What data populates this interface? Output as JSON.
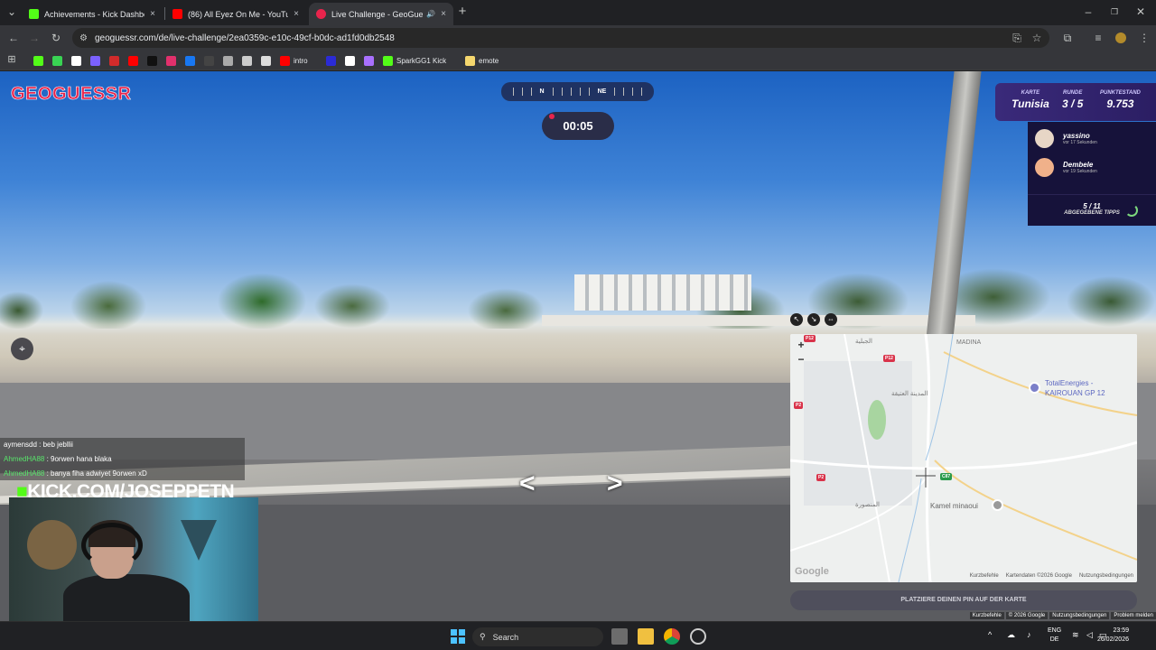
{
  "browser": {
    "tabs": [
      {
        "title": "Achievements - Kick Dashboard",
        "fav": "#53fc18"
      },
      {
        "title": "(86) All Eyez On Me - YouTube",
        "fav": "#ff0000"
      },
      {
        "title": "Live Challenge - GeoGuessr",
        "fav": "#e8244c"
      }
    ],
    "new_tab": "+",
    "close_label": "×",
    "url": "geoguessr.com/de/live-challenge/2ea0359c-e10c-49cf-b0dc-ad1fd0db2548",
    "bookmarks": [
      {
        "label": "",
        "color": "#53fc18"
      },
      {
        "label": "",
        "color": "#39d353"
      },
      {
        "label": "",
        "color": "#ffffff"
      },
      {
        "label": "",
        "color": "#7b61ff"
      },
      {
        "label": "",
        "color": "#d12b2b"
      },
      {
        "label": "",
        "color": "#ff0000"
      },
      {
        "label": "",
        "color": "#111111"
      },
      {
        "label": "",
        "color": "#e1306c"
      },
      {
        "label": "",
        "color": "#1877f2"
      },
      {
        "label": "",
        "color": "#444444"
      },
      {
        "label": "",
        "color": "#aaaaaa"
      },
      {
        "label": "",
        "color": "#cccccc"
      },
      {
        "label": "",
        "color": "#dddddd"
      },
      {
        "label": "intro",
        "color": "#ff0000"
      },
      {
        "label": "",
        "color": "#2b2bd6"
      },
      {
        "label": "",
        "color": "#ffffff"
      },
      {
        "label": "",
        "color": "#a970ff"
      },
      {
        "label": "SparkGG1 Kick",
        "color": "#53fc18"
      },
      {
        "label": "emote",
        "color": "#f5d76e"
      }
    ]
  },
  "game": {
    "logo": "GEOGUESSR",
    "compass": {
      "marks": [
        "N",
        "NE"
      ]
    },
    "timer": "00:05",
    "score": {
      "map_label": "KARTE",
      "map_value": "Tunisia",
      "round_label": "RUNDE",
      "round_value": "3 / 5",
      "points_label": "PUNKTESTAND",
      "points_value": "9.753"
    },
    "players": [
      {
        "name": "yassino",
        "time": "vor 17 Sekunden"
      },
      {
        "name": "Dembele",
        "time": "vor 19 Sekunden"
      }
    ],
    "guesses": {
      "count": "5 / 11",
      "label": "ABGEGEBENE TIPPS"
    },
    "map": {
      "labels": {
        "madina": "MADINA",
        "total": "TotalEnergies -",
        "total2": "KAIROUAN GP 12",
        "kamel": "Kamel minaoui",
        "ar1": "الجبلية",
        "ar2": "المنصورة",
        "ar3": "المدينة العتيقة"
      },
      "badges": [
        "P12",
        "P2",
        "P2",
        "C87",
        "P12"
      ],
      "google": "Google",
      "footer": [
        "Kurzbefehle",
        "Kartendaten ©2026 Google",
        "Nutzungsbedingungen"
      ]
    },
    "guess_button": "PLATZIERE DEINEN PIN AUF DER KARTE",
    "bottom_footer": [
      "Kurzbefehle",
      "© 2026 Google",
      "Nutzungsbedingungen",
      "Problem melden"
    ]
  },
  "stream": {
    "chat": [
      {
        "user": "aymensdd",
        "text": " : beb jebllii"
      },
      {
        "user": "AhmedHA88",
        "text": " : 9orwen hana blaka"
      },
      {
        "user": "AhmedHA88",
        "text": " : banya fiha adwiyet 9orwen xD"
      }
    ],
    "kick_url": "KICK.COM/JOSEPPETN"
  },
  "taskbar": {
    "search": "Search",
    "lang": "ENG",
    "lang2": "DE",
    "time": "23:59",
    "date": "26/02/2026"
  }
}
